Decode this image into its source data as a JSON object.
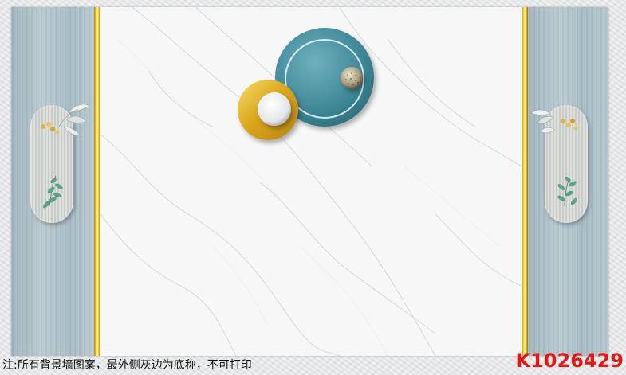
{
  "footer": {
    "note": "注:所有背景墙图案，最外侧灰边为底称，不可打印",
    "product_code": "K1026429"
  },
  "colors": {
    "panel_blue_gray": "#a9bdc5",
    "gold": "#e7c531",
    "marble_white": "#f7f7f8",
    "teal_disc": "#4f97a5",
    "product_code_red": "#e01818"
  }
}
